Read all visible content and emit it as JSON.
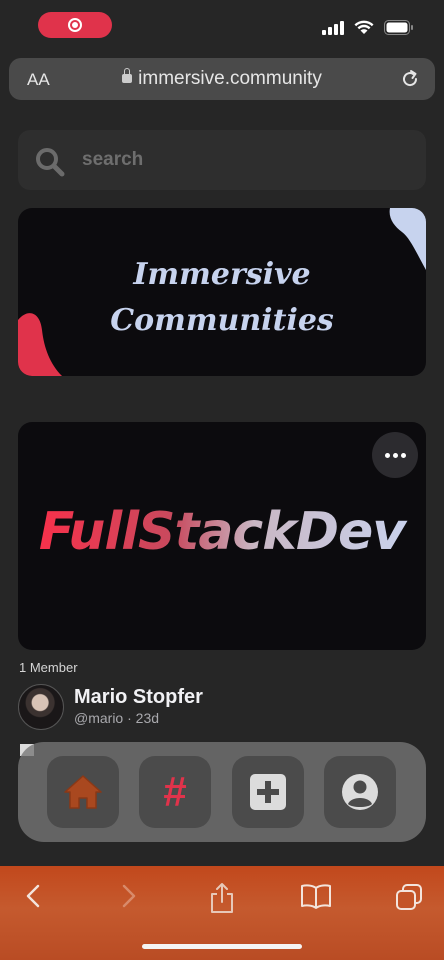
{
  "browser": {
    "text_size_label": "AA",
    "url": "immersive.community"
  },
  "search": {
    "placeholder": "search"
  },
  "banner": {
    "line1": "Immersive",
    "line2": "Communities"
  },
  "community": {
    "name": "FullStackDev",
    "member_count": "1 Member"
  },
  "post": {
    "author_name": "Mario Stopfer",
    "author_meta": "@mario · 23d"
  },
  "nav": [
    {
      "name": "home",
      "icon": "home-icon"
    },
    {
      "name": "tags",
      "icon": "hashtag-icon"
    },
    {
      "name": "create",
      "icon": "plus-square-icon"
    },
    {
      "name": "profile",
      "icon": "user-circle-icon"
    }
  ],
  "colors": {
    "accent": "#e0334b",
    "background": "#262626",
    "card": "#0c0b0e",
    "banner_text": "#c7d3ee",
    "toolbar": "#c2481c"
  }
}
